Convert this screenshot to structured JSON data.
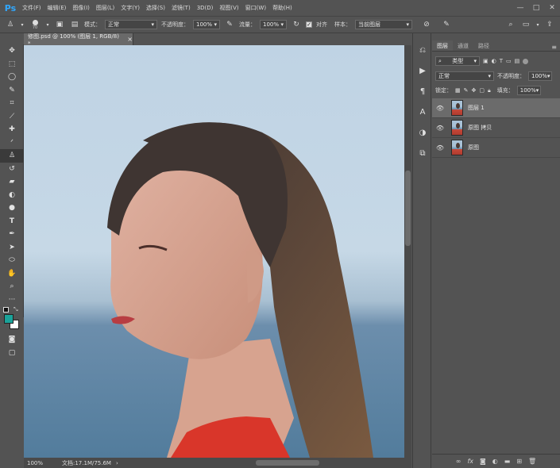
{
  "app": {
    "logo": "Ps"
  },
  "menu": [
    "文件(F)",
    "编辑(E)",
    "图像(I)",
    "图层(L)",
    "文字(Y)",
    "选择(S)",
    "滤镜(T)",
    "3D(D)",
    "视图(V)",
    "窗口(W)",
    "帮助(H)"
  ],
  "window_controls": {
    "minimize": "—",
    "maximize": "□",
    "close": "✕"
  },
  "options": {
    "brush_size": "70",
    "mode_label": "模式：",
    "mode_value": "正常",
    "opacity_label": "不透明度：",
    "opacity_value": "100%",
    "flow_label": "流量：",
    "flow_value": "100%",
    "aligned_label": "对齐",
    "sample_label": "样本：",
    "sample_value": "当前图层"
  },
  "document": {
    "tab_title": "修图.psd @ 100% (图层 1, RGB/8) *",
    "close": "×",
    "zoom": "100%",
    "doc_info": "文档:17.1M/75.6M"
  },
  "layers_panel": {
    "tabs": [
      "图层",
      "通道",
      "路径"
    ],
    "filter_kind": "类型",
    "blend_mode": "正常",
    "opacity_label": "不透明度：",
    "opacity_value": "100%",
    "lock_label": "锁定：",
    "fill_label": "填充：",
    "fill_value": "100%",
    "layers": [
      {
        "name": "图层 1",
        "active": true
      },
      {
        "name": "原图 拷贝",
        "active": false
      },
      {
        "name": "原图",
        "active": false
      }
    ]
  },
  "colors": {
    "foreground": "#1aa39a",
    "background": "#ffffff",
    "accent": "#31a8ff"
  }
}
